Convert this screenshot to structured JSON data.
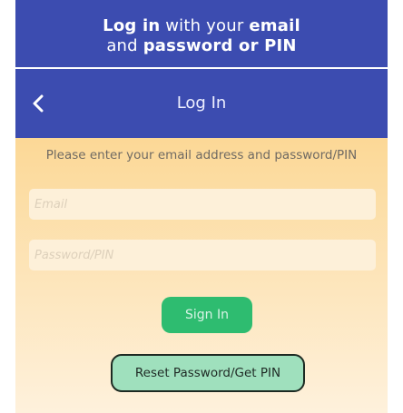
{
  "banner": {
    "line1_bold": "Log in",
    "line1_rest": " with your ",
    "line1_bold2": "email",
    "line2_rest": "and ",
    "line2_bold": "password or PIN"
  },
  "nav": {
    "back_icon": "chevron-left-icon",
    "title": "Log In"
  },
  "form": {
    "instruction": "Please enter your email address and password/PIN",
    "email_placeholder": "Email",
    "password_placeholder": "Password/PIN",
    "sign_in_label": "Sign In",
    "reset_label": "Reset Password/Get PIN"
  },
  "colors": {
    "header_bg": "#3c4cb0",
    "sign_in_bg": "#2ebc70",
    "reset_bg": "#9fe0bd",
    "content_gradient_top": "#fcd896"
  }
}
